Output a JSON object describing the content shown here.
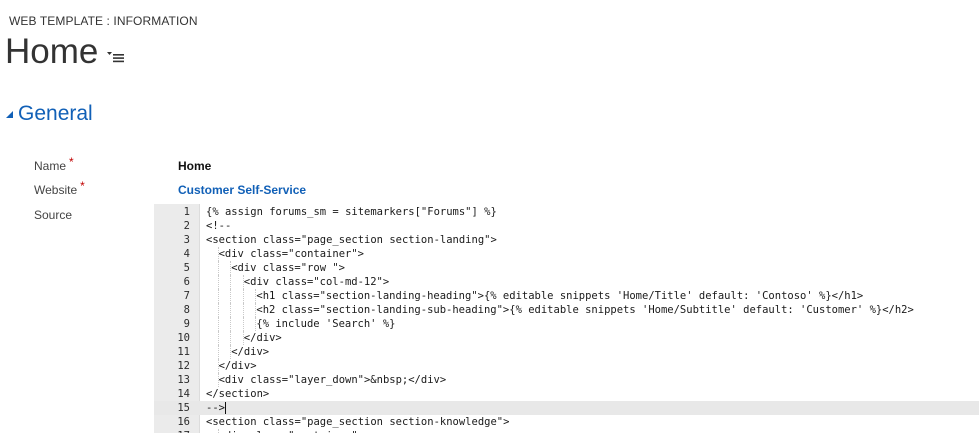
{
  "entity_label": "WEB TEMPLATE : INFORMATION",
  "title": "Home",
  "section": {
    "title": "General"
  },
  "fields": {
    "name_label": "Name",
    "name_required": "*",
    "name_value": "Home",
    "website_label": "Website",
    "website_required": "*",
    "website_value": "Customer Self-Service",
    "source_label": "Source"
  },
  "editor": {
    "active_line": 15,
    "lines": [
      {
        "n": "1",
        "indent": 0,
        "text": "{% assign forums_sm = sitemarkers[\"Forums\"] %}"
      },
      {
        "n": "2",
        "indent": 0,
        "text": "<!--"
      },
      {
        "n": "3",
        "indent": 0,
        "text": "<section class=\"page_section section-landing\">"
      },
      {
        "n": "4",
        "indent": 1,
        "text": "<div class=\"container\">"
      },
      {
        "n": "5",
        "indent": 2,
        "text": "<div class=\"row \">"
      },
      {
        "n": "6",
        "indent": 3,
        "text": "<div class=\"col-md-12\">"
      },
      {
        "n": "7",
        "indent": 4,
        "text": "<h1 class=\"section-landing-heading\">{% editable snippets 'Home/Title' default: 'Contoso' %}</h1>"
      },
      {
        "n": "8",
        "indent": 4,
        "text": "<h2 class=\"section-landing-sub-heading\">{% editable snippets 'Home/Subtitle' default: 'Customer' %}</h2>"
      },
      {
        "n": "9",
        "indent": 4,
        "text": "{% include 'Search' %}"
      },
      {
        "n": "10",
        "indent": 3,
        "text": "</div>"
      },
      {
        "n": "11",
        "indent": 2,
        "text": "</div>"
      },
      {
        "n": "12",
        "indent": 1,
        "text": "</div>"
      },
      {
        "n": "13",
        "indent": 1,
        "text": "<div class=\"layer_down\">&nbsp;</div>"
      },
      {
        "n": "14",
        "indent": 0,
        "text": "</section>"
      },
      {
        "n": "15",
        "indent": 0,
        "text": "-->"
      },
      {
        "n": "16",
        "indent": 0,
        "text": "<section class=\"page_section section-knowledge\">"
      },
      {
        "n": "17",
        "indent": 1,
        "text": "<div class=\"container\">"
      }
    ]
  }
}
